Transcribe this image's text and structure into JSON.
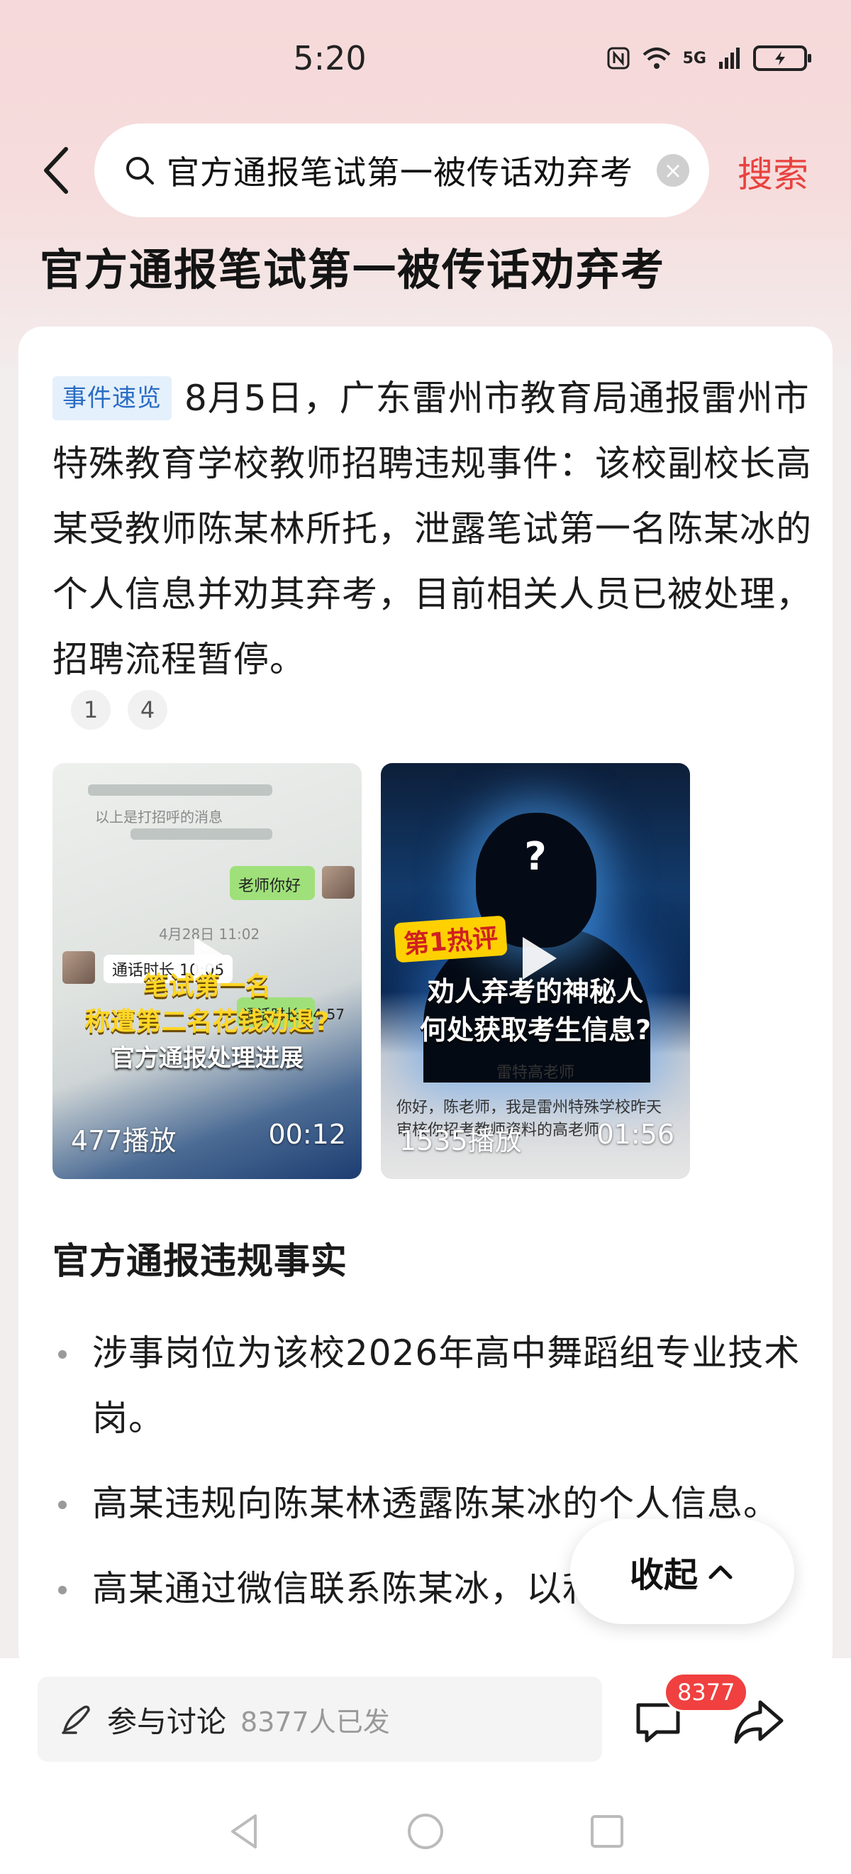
{
  "status_bar": {
    "time": "5:20",
    "network": "5G",
    "icons": [
      "nfc-icon",
      "wifi-icon",
      "signal-icon",
      "battery-charging-icon"
    ]
  },
  "header": {
    "search_query": "官方通报笔试第一被传话劝弃考",
    "search_button": "搜索"
  },
  "page_title": "官方通报笔试第一被传话劝弃考",
  "summary": {
    "tag": "事件速览",
    "text": "8月5日，广东雷州市教育局通报雷州市特殊教育学校教师招聘违规事件：该校副校长高某受教师陈某林所托，泄露笔试第一名陈某冰的个人信息并劝其弃考，目前相关人员已被处理，招聘流程暂停。",
    "refs": [
      "1",
      "4"
    ]
  },
  "videos": [
    {
      "overlay_line1": "笔试第一名",
      "overlay_line2": "称遭第二名花钱劝退?",
      "overlay_line3": "官方通报处理进展",
      "chat_top": "以上是打招呼的消息",
      "chat_reply": "老师你好",
      "chat_date": "4月28日 11:02",
      "call_text": "通话时长 10:05",
      "call_text_2": "通话时长 04:57",
      "plays": "477播放",
      "duration": "00:12"
    },
    {
      "badge": "第1热评",
      "question_mark": "?",
      "banner_line1": "劝人弃考的神秘人",
      "banner_line2": "何处获取考生信息?",
      "doc_name": "雷特高老师",
      "doc_text": "你好，陈老师，我是雷州特殊学校昨天审核你招考教师资料的高老师",
      "plays": "1535播放",
      "duration": "01:56"
    }
  ],
  "facts": {
    "heading": "官方通报违规事实",
    "items": [
      "涉事岗位为该校2026年高中舞蹈组专业技术岗。",
      "高某违规向陈某林透露陈某冰的个人信息。",
      "高某通过微信联系陈某冰，以利益许诺"
    ]
  },
  "collapse_button": "收起",
  "bottom_bar": {
    "discuss_label": "参与讨论",
    "discuss_count": "8377人已发",
    "comment_badge": "8377"
  },
  "colors": {
    "accent": "#e8423f",
    "tag_bg": "#e4f0fb",
    "tag_text": "#2a6cc4",
    "badge": "#f04040"
  }
}
